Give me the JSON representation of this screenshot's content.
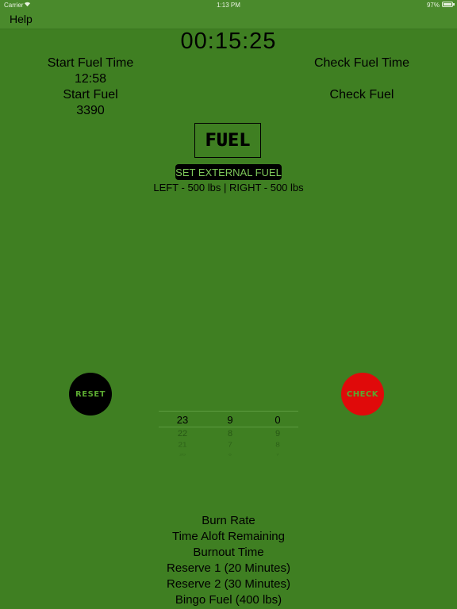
{
  "status_bar": {
    "carrier": "Carrier",
    "time": "1:13 PM",
    "battery": "97%"
  },
  "nav": {
    "help_label": "Help"
  },
  "timer": "00:15:25",
  "left_info": {
    "start_fuel_time_label": "Start Fuel Time",
    "start_fuel_time_value": "12:58",
    "start_fuel_label": "Start Fuel",
    "start_fuel_value": "3390"
  },
  "right_info": {
    "check_fuel_time_label": "Check Fuel Time",
    "check_fuel_label": "Check Fuel"
  },
  "fuel_logo_text": "FUEL",
  "set_external_fuel_label": "SET EXTERNAL FUEL",
  "external_fuel_text": "LEFT - 500 lbs | RIGHT - 500 lbs",
  "reset_label": "RESET",
  "check_label": "CHECK",
  "picker": {
    "columns": [
      {
        "selected": "23",
        "next": [
          "22",
          "21",
          "20"
        ]
      },
      {
        "selected": "9",
        "next": [
          "8",
          "7",
          "6"
        ]
      },
      {
        "selected": "0",
        "next": [
          "9",
          "8",
          "7"
        ]
      }
    ]
  },
  "stats": {
    "burn_rate": "Burn Rate",
    "time_aloft": "Time Aloft Remaining",
    "burnout_time": "Burnout Time",
    "reserve1": "Reserve 1 (20 Minutes)",
    "reserve2": "Reserve 2 (30 Minutes)",
    "bingo_fuel": "Bingo Fuel (400 lbs)"
  },
  "colors": {
    "background": "#3f7f22",
    "nav_background": "#4a8a2c",
    "check_button": "#e00a0a",
    "button_text": "#5aa830"
  }
}
